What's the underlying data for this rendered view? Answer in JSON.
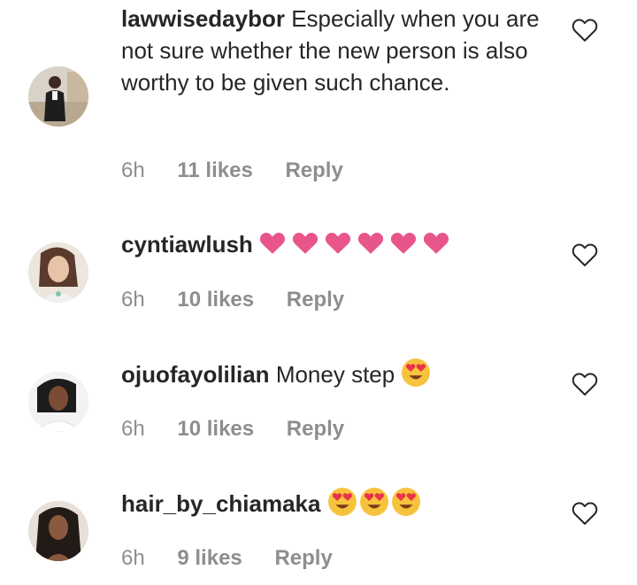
{
  "colors": {
    "text": "#262626",
    "meta": "#8e8e8e",
    "heart_pink": "#e8558a",
    "emoji_yellow": "#f7c23c",
    "emoji_heart_eyes": "#e8334a"
  },
  "comments": [
    {
      "username": "lawwisedaybor",
      "text": "Especially when you are not sure whether the new person is also worthy to be given such chance.",
      "emoji": [],
      "time": "6h",
      "likes": "11 likes",
      "reply": "Reply",
      "like_icon": "heart-outline-icon"
    },
    {
      "username": "cyntiawlush",
      "text": "",
      "emoji": [
        "pink-heart",
        "pink-heart",
        "pink-heart",
        "pink-heart",
        "pink-heart",
        "pink-heart"
      ],
      "time": "6h",
      "likes": "10 likes",
      "reply": "Reply",
      "like_icon": "heart-outline-icon"
    },
    {
      "username": "ojuofayolilian",
      "text": "Money step",
      "emoji": [
        "heart-eyes-face"
      ],
      "time": "6h",
      "likes": "10 likes",
      "reply": "Reply",
      "like_icon": "heart-outline-icon"
    },
    {
      "username": "hair_by_chiamaka",
      "text": "",
      "emoji": [
        "heart-eyes-face",
        "heart-eyes-face",
        "heart-eyes-face"
      ],
      "time": "6h",
      "likes": "9 likes",
      "reply": "Reply",
      "like_icon": "heart-outline-icon"
    }
  ]
}
